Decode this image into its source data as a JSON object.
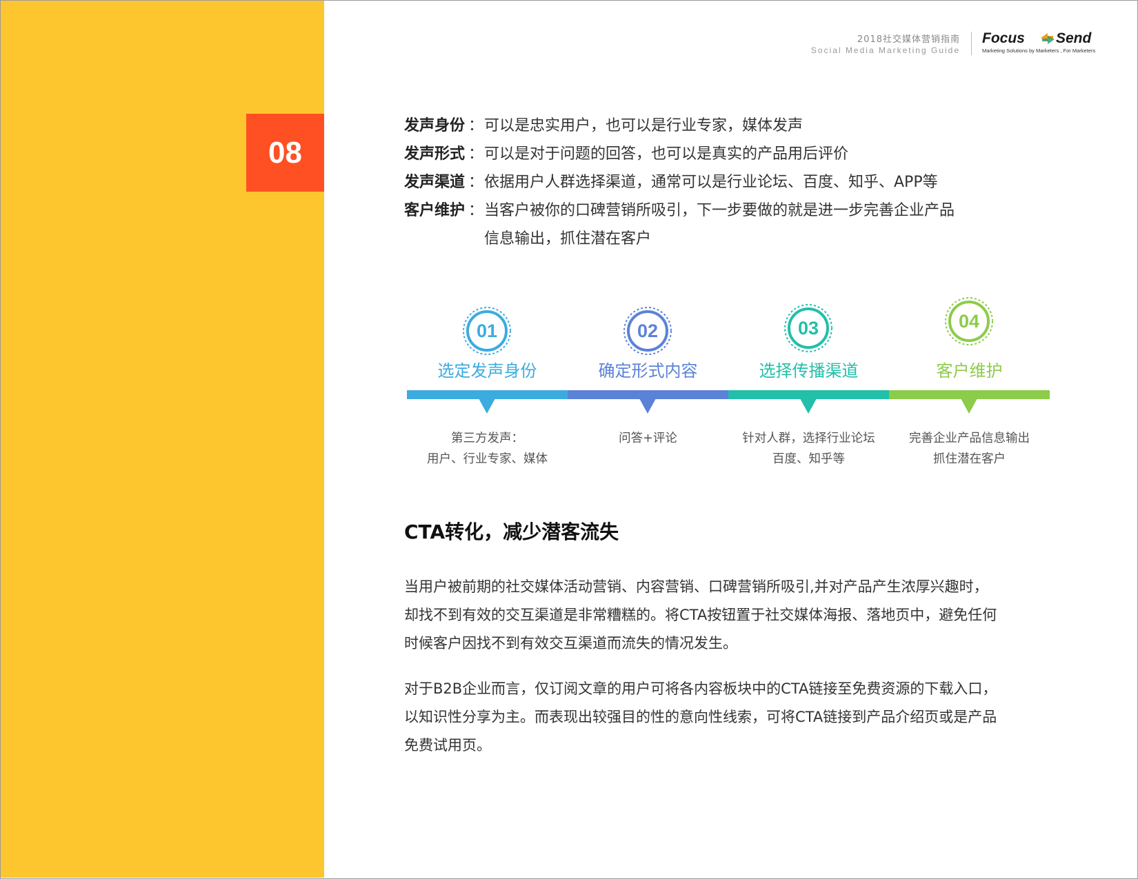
{
  "page_number": "08",
  "header": {
    "guide_title_cn": "2018社交媒体营销指南",
    "guide_title_en": "Social Media Marketing Guide",
    "logo_focus": "Focus",
    "logo_send": "Send",
    "logo_tagline": "Marketing Solutions by Marketers , For Marketers"
  },
  "definitions": [
    {
      "term": "发声身份",
      "colon": "：",
      "desc": "可以是忠实用户，也可以是行业专家，媒体发声"
    },
    {
      "term": "发声形式",
      "colon": "：",
      "desc": "可以是对于问题的回答，也可以是真实的产品用后评价"
    },
    {
      "term": "发声渠道",
      "colon": "：",
      "desc": "依据用户人群选择渠道，通常可以是行业论坛、百度、知乎、APP等"
    },
    {
      "term": "客户维护",
      "colon": "：",
      "desc": "当客户被你的口碑营销所吸引，下一步要做的就是进一步完善企业产品"
    }
  ],
  "definition_continuation": "信息输出，抓住潜在客户",
  "steps": [
    {
      "num": "01",
      "title": "选定发声身份",
      "desc_line1": "第三方发声：",
      "desc_line2": "用户、行业专家、媒体",
      "color": "#3cabe0"
    },
    {
      "num": "02",
      "title": "确定形式内容",
      "desc_line1": "问答+评论",
      "desc_line2": "",
      "color": "#5b82d9"
    },
    {
      "num": "03",
      "title": "选择传播渠道",
      "desc_line1": "针对人群，选择行业论坛",
      "desc_line2": "百度、知乎等",
      "color": "#22bfa9"
    },
    {
      "num": "04",
      "title": "客户维护",
      "desc_line1": "完善企业产品信息输出",
      "desc_line2": "抓住潜在客户",
      "color": "#8dcb4a"
    }
  ],
  "section_heading": "CTA转化，减少潜客流失",
  "paragraph1_lines": [
    "当用户被前期的社交媒体活动营销、内容营销、口碑营销所吸引,并对产品产生浓厚兴趣时，",
    "却找不到有效的交互渠道是非常糟糕的。将CTA按钮置于社交媒体海报、落地页中，避免任何",
    "时候客户因找不到有效交互渠道而流失的情况发生。"
  ],
  "paragraph2_lines": [
    "对于B2B企业而言，仅订阅文章的用户可将各内容板块中的CTA链接至免费资源的下载入口，",
    "以知识性分享为主。而表现出较强目的性的意向性线索，可将CTA链接到产品介绍页或是产品",
    "免费试用页。"
  ],
  "colors": {
    "sidebar": "#fdc62f",
    "page_number_bg": "#ff5024"
  }
}
